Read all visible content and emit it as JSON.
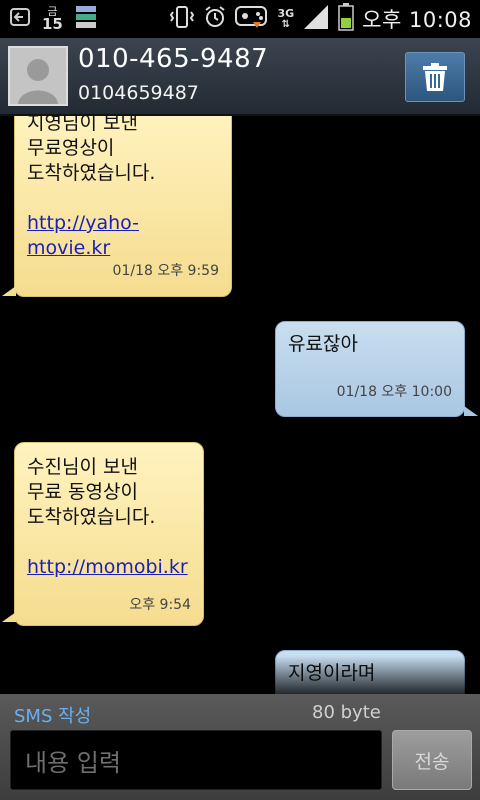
{
  "status_bar": {
    "calendar_day_label": "금",
    "calendar_day_number": "15",
    "network_type": "3G",
    "time": "오후 10:08",
    "icons": [
      "back-notification-icon",
      "calendar-icon",
      "storage-icon",
      "vibrate-icon",
      "alarm-icon",
      "game-icon",
      "3g-icon",
      "signal-icon",
      "battery-icon"
    ]
  },
  "header": {
    "title": "010-465-9487",
    "subtitle": "0104659487"
  },
  "messages": [
    {
      "direction": "in",
      "text_lines": [
        "지영님이 보낸",
        "무료영상이",
        "도착하였습니다."
      ],
      "link": "http://yaho-movie.kr",
      "time": "01/18 오후 9:59"
    },
    {
      "direction": "out",
      "text_lines": [
        "유료잖아"
      ],
      "time": "01/18 오후 10:00"
    },
    {
      "direction": "in",
      "text_lines": [
        "수진님이 보낸",
        "무료 동영상이",
        "도착하였습니다."
      ],
      "link": "http://momobi.kr",
      "time": "오후 9:54"
    },
    {
      "direction": "out",
      "text_lines": [
        "지영이라며"
      ]
    }
  ],
  "composer": {
    "label": "SMS 작성",
    "byte_count": "80 byte",
    "input_placeholder": "내용 입력",
    "send_label": "전송"
  },
  "colors": {
    "incoming_bubble": "#f5dc8f",
    "outgoing_bubble": "#a9c7e2",
    "link": "#1a1fb8",
    "sms_label": "#6ab0ee"
  }
}
